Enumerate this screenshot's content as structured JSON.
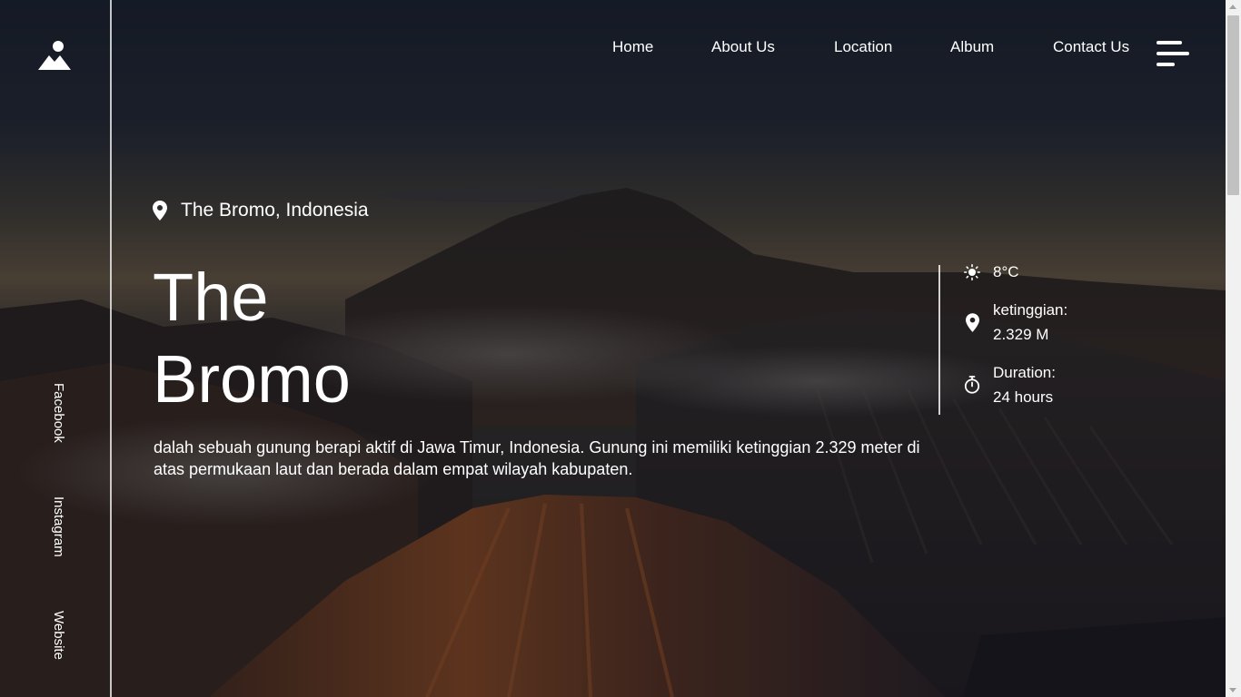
{
  "nav": {
    "items": [
      {
        "label": "Home"
      },
      {
        "label": "About Us"
      },
      {
        "label": "Location"
      },
      {
        "label": "Album"
      },
      {
        "label": "Contact Us"
      }
    ],
    "menu_icon": "hamburger-menu-icon"
  },
  "logo": {
    "icon": "mountain-person-logo-icon"
  },
  "social": [
    {
      "label": "Facebook"
    },
    {
      "label": "Instagram"
    },
    {
      "label": "Website"
    }
  ],
  "hero": {
    "location": "The Bromo, Indonesia",
    "location_icon": "map-pin-icon",
    "title_line1": "The",
    "title_line2": "Bromo",
    "description": "dalah sebuah gunung berapi aktif di Jawa Timur, Indonesia. Gunung ini memiliki ketinggian 2.329 meter di atas permukaan laut dan berada dalam empat wilayah kabupaten."
  },
  "info": {
    "temperature": {
      "icon": "sun-icon",
      "value": "8°C"
    },
    "altitude": {
      "icon": "map-pin-icon",
      "label": "ketinggian:",
      "value": "2.329 M"
    },
    "duration": {
      "icon": "stopwatch-icon",
      "label": "Duration:",
      "value": "24 hours"
    }
  },
  "colors": {
    "text": "#ffffff",
    "overlay": "#0a0c14"
  }
}
